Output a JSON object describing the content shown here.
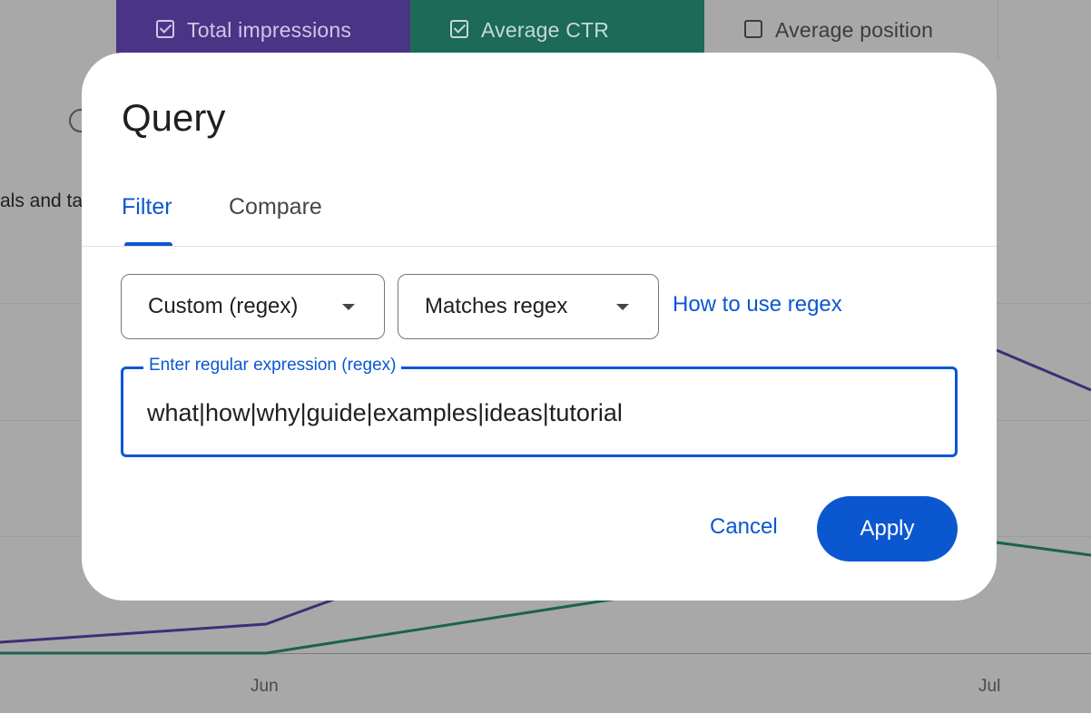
{
  "background": {
    "metrics": {
      "impressions": {
        "label": "Total impressions",
        "checked": true,
        "color": "#4a3486"
      },
      "ctr": {
        "label": "Average CTR",
        "checked": true,
        "color": "#1c6a57"
      },
      "position": {
        "label": "Average position",
        "checked": false
      }
    },
    "truncated_text": "als and ta",
    "x_axis": {
      "labels": [
        "Jun",
        "Jul"
      ]
    }
  },
  "dialog": {
    "title": "Query",
    "tabs": [
      {
        "label": "Filter",
        "active": true
      },
      {
        "label": "Compare",
        "active": false
      }
    ],
    "field_select": {
      "value": "Custom (regex)"
    },
    "operator_select": {
      "value": "Matches regex"
    },
    "help_link": "How to use regex",
    "regex_input": {
      "label": "Enter regular expression (regex)",
      "value": "what|how|why|guide|examples|ideas|tutorial"
    },
    "cancel_label": "Cancel",
    "apply_label": "Apply",
    "accent_color": "#0b57d0"
  }
}
